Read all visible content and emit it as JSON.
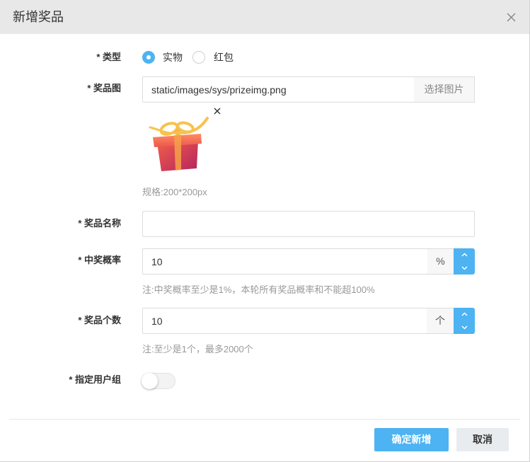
{
  "dialog": {
    "title": "新增奖品",
    "close_icon": "close-icon"
  },
  "form": {
    "type": {
      "label": "* 类型",
      "options": [
        {
          "label": "实物",
          "selected": true
        },
        {
          "label": "红包",
          "selected": false
        }
      ]
    },
    "prize_image": {
      "label": "* 奖品图",
      "value": "static/images/sys/prizeimg.png",
      "choose_button": "选择图片",
      "preview_image": "gift-box-image",
      "remove_icon": "close-icon",
      "hint": "规格:200*200px"
    },
    "prize_name": {
      "label": "* 奖品名称",
      "value": ""
    },
    "win_rate": {
      "label": "* 中奖概率",
      "value": "10",
      "unit": "%",
      "spinner_icons": [
        "chevron-up-icon",
        "chevron-down-icon"
      ],
      "hint": "注:中奖概率至少是1%，本轮所有奖品概率和不能超100%"
    },
    "prize_count": {
      "label": "* 奖品个数",
      "value": "10",
      "unit": "个",
      "spinner_icons": [
        "chevron-up-icon",
        "chevron-down-icon"
      ],
      "hint": "注:至少是1个，最多2000个"
    },
    "user_group": {
      "label": "* 指定用户组",
      "enabled": false
    }
  },
  "footer": {
    "confirm_label": "确定新增",
    "cancel_label": "取消"
  },
  "colors": {
    "accent": "#4db3f2",
    "header_bg": "#e8e8e8",
    "hint_text": "#999999",
    "cancel_bg": "#e9ecee"
  }
}
